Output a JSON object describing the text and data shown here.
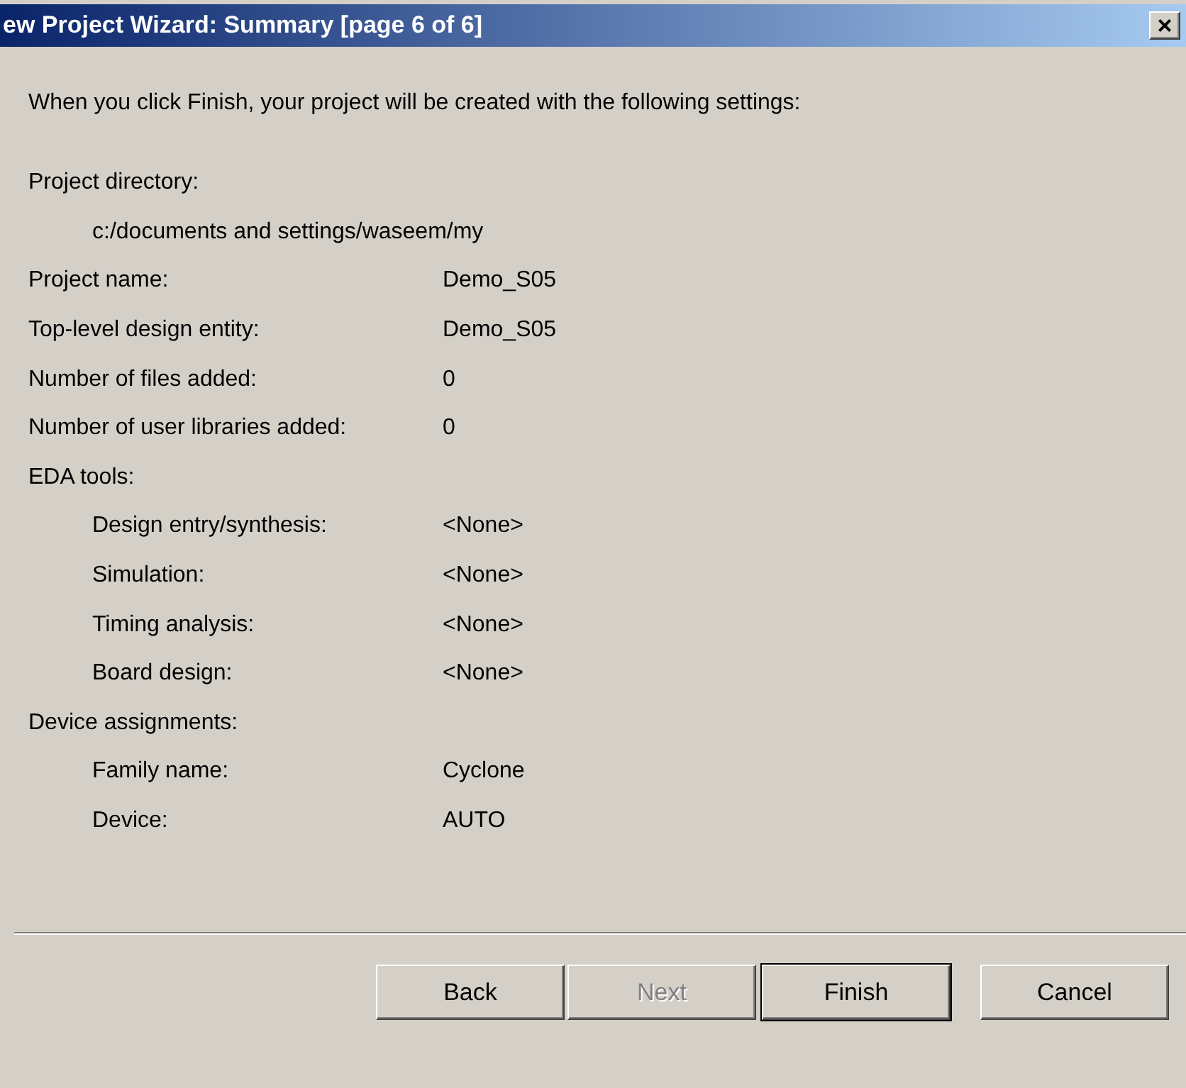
{
  "window": {
    "title": "ew Project Wizard: Summary [page 6 of 6]",
    "close": "×"
  },
  "intro": "When you click Finish, your project will be created with the following settings:",
  "rows": [
    {
      "kind": "heading",
      "label": "Project directory:"
    },
    {
      "kind": "path",
      "value": "c:/documents and settings/waseem/my"
    },
    {
      "kind": "pair",
      "label": "Project name:",
      "value": "Demo_S05"
    },
    {
      "kind": "pair",
      "label": "Top-level design entity:",
      "value": "Demo_S05"
    },
    {
      "kind": "pair",
      "label": "Number of files added:",
      "value": "0"
    },
    {
      "kind": "pair",
      "label": "Number of user libraries added:",
      "value": "0"
    },
    {
      "kind": "heading",
      "label": "EDA tools:"
    },
    {
      "kind": "subpair",
      "label": "Design entry/synthesis:",
      "value": "<None>"
    },
    {
      "kind": "subpair",
      "label": "Simulation:",
      "value": "<None>"
    },
    {
      "kind": "subpair",
      "label": "Timing analysis:",
      "value": "<None>"
    },
    {
      "kind": "subpair",
      "label": "Board design:",
      "value": "<None>"
    },
    {
      "kind": "heading",
      "label": "Device assignments:"
    },
    {
      "kind": "subpair",
      "label": "Family name:",
      "value": "Cyclone"
    },
    {
      "kind": "subpair",
      "label": "Device:",
      "value": "AUTO"
    }
  ],
  "buttons": [
    {
      "label": "Back",
      "disabled": false,
      "default": false
    },
    {
      "label": "Next",
      "disabled": true,
      "default": false
    },
    {
      "label": "Finish",
      "disabled": false,
      "default": true
    },
    {
      "label": "Cancel",
      "disabled": false,
      "default": false
    }
  ]
}
